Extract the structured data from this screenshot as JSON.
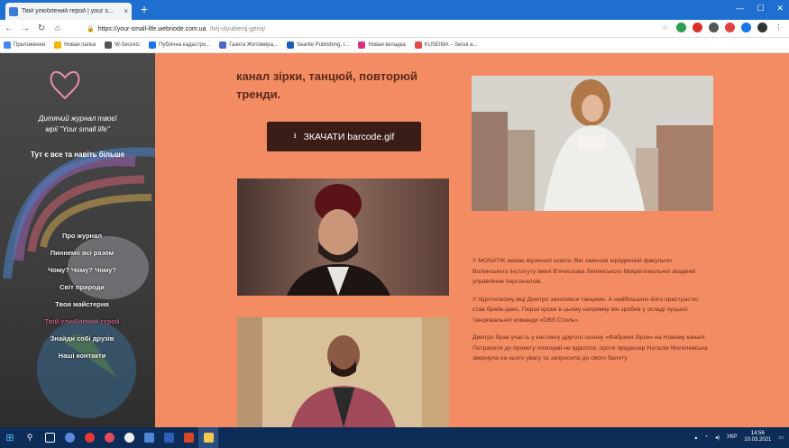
{
  "browser": {
    "tab_title": "Твій улюблений герой | your s...",
    "tab_close": "×",
    "new_tab": "+",
    "url_host": "https://your-small-life.webnode.com.ua",
    "url_path": "/tvij-ulyublenij-geroj/",
    "bookmarks": [
      "Приложения",
      "Новая папка",
      "W-Secrets",
      "Публічна кадастро...",
      "Газета Житомира...",
      "Seartle Publishing, I...",
      "Новая вкладка",
      "KUSEIMA – Seoul a..."
    ]
  },
  "sidebar": {
    "title_line1": "Дитячий журнал твоєї",
    "title_line2": "мрії \"Your small life\"",
    "tagline": "Тут є все та навіть більше",
    "menu": [
      "Про журнал",
      "Пиннемо всі разом",
      "Чому? Чому? Чому?",
      "Світ природи",
      "Твоя майстерня",
      "Твій улюблений герой",
      "Знайди собі друзів",
      "Наші контакти"
    ]
  },
  "content": {
    "headline": "канал зірки, танцюй, повторюй тренди.",
    "download_label": "ЗКАЧАТИ barcode.gif",
    "paragraphs": [
      "У MONATIK немає музичної освіти. Він закінчив юридичний факультет Волинського інституту імені В'ячеслава Липинського Міжрегіональної академії управління персоналом.",
      "У підлітковому віці Дмитро захопився танцями. А найбільшою його пристрастю став брейк-данс. Перші кроки в цьому напрямку він зробив у складі луцької танцювальної команди «DBS Стиль».",
      "Дмитро брав участь у кастингу другого сезону «Фабрики Зірок» на Новому каналі. Потрапити до проекту хлопцеві не вдалося, проте продюсер Наталія Могилевська звернула на нього увагу та запросила до свого балету."
    ]
  },
  "taskbar": {
    "lang": "УКР",
    "time": "14:56",
    "date": "10.03.2021"
  },
  "colors": {
    "page_bg": "#f48c63",
    "button_bg": "#3a1d17",
    "active_menu": "#b95d7c"
  }
}
